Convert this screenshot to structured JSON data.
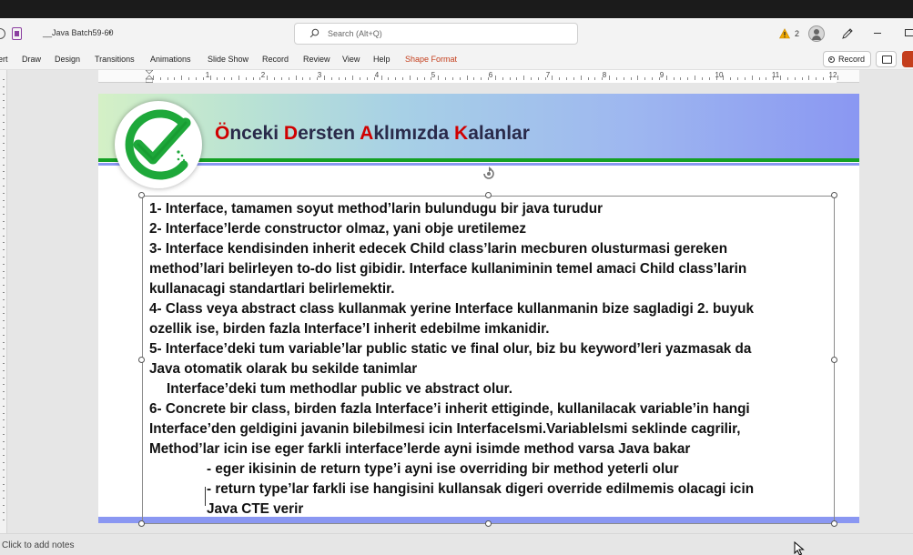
{
  "titlebar": {
    "filename": "__Java Batch59-60",
    "search_placeholder": "Search (Alt+Q)",
    "warning_count": "2"
  },
  "ribbon": {
    "tabs": [
      "ert",
      "Draw",
      "Design",
      "Transitions",
      "Animations",
      "Slide Show",
      "Record",
      "Review",
      "View",
      "Help",
      "Shape Format"
    ],
    "record_label": "Record"
  },
  "ruler": {
    "numbers": [
      "1",
      "1",
      "2",
      "3",
      "4",
      "5",
      "6",
      "7",
      "8",
      "9",
      "10",
      "11",
      "12"
    ]
  },
  "slide": {
    "title_parts": [
      {
        "text": "Ö",
        "cap": true
      },
      {
        "text": "nceki ",
        "cap": false
      },
      {
        "text": "D",
        "cap": true
      },
      {
        "text": "ersten ",
        "cap": false
      },
      {
        "text": "A",
        "cap": true
      },
      {
        "text": "klımızda ",
        "cap": false
      },
      {
        "text": "K",
        "cap": true
      },
      {
        "text": "alanlar",
        "cap": false
      }
    ],
    "lines": [
      {
        "text": "1- Interface, tamamen soyut method’larin bulundugu bir java turudur",
        "indent": 0
      },
      {
        "text": "2- Interface’lerde constructor olmaz, yani obje uretilemez",
        "indent": 0
      },
      {
        "text": "3- Interface kendisinden inherit edecek Child class’larin mecburen olusturmasi gereken",
        "indent": 0
      },
      {
        "text": "method’lari belirleyen to-do list gibidir. Interface kullaniminin temel amaci  Child class’larin",
        "indent": 0
      },
      {
        "text": "kullanacagi standartlari belirlemektir.",
        "indent": 0
      },
      {
        "text": "4- Class veya abstract class kullanmak yerine Interface kullanmanin bize sagladigi 2. buyuk",
        "indent": 0
      },
      {
        "text": "ozellik ise, birden fazla Interface’I inherit edebilme imkanidir.",
        "indent": 0
      },
      {
        "text": "5- Interface’deki tum variable’lar public static ve final olur, biz bu keyword’leri yazmasak da",
        "indent": 0
      },
      {
        "text": "Java otomatik olarak bu sekilde tanimlar",
        "indent": 0
      },
      {
        "text": "Interface’deki tum methodlar public ve abstract olur.",
        "indent": 1
      },
      {
        "text": "6- Concrete bir class, birden fazla Interface’i inherit ettiginde, kullanilacak variable’in hangi",
        "indent": 0
      },
      {
        "text": "Interface’den geldigini javanin bilebilmesi icin InterfaceIsmi.VariableIsmi seklinde cagrilir,",
        "indent": 0
      },
      {
        "text": "Method’lar icin ise eger farkli interface’lerde ayni isimde method varsa Java bakar",
        "indent": 0
      },
      {
        "text": "- eger ikisinin de return type’i ayni ise overriding bir method yeterli olur",
        "indent": 2
      },
      {
        "text": "- return type’lar farkli ise hangisini kullansak digeri override edilmemis olacagi icin",
        "indent": 2
      },
      {
        "text": "Java CTE verir",
        "indent": 2
      }
    ]
  },
  "status": {
    "notes_placeholder": "Click to add notes"
  },
  "colors": {
    "accent_red": "#d00000",
    "shape_format_orange": "#c43e1c",
    "banner_blue": "#8a97f2",
    "banner_green_line": "#14a024"
  }
}
